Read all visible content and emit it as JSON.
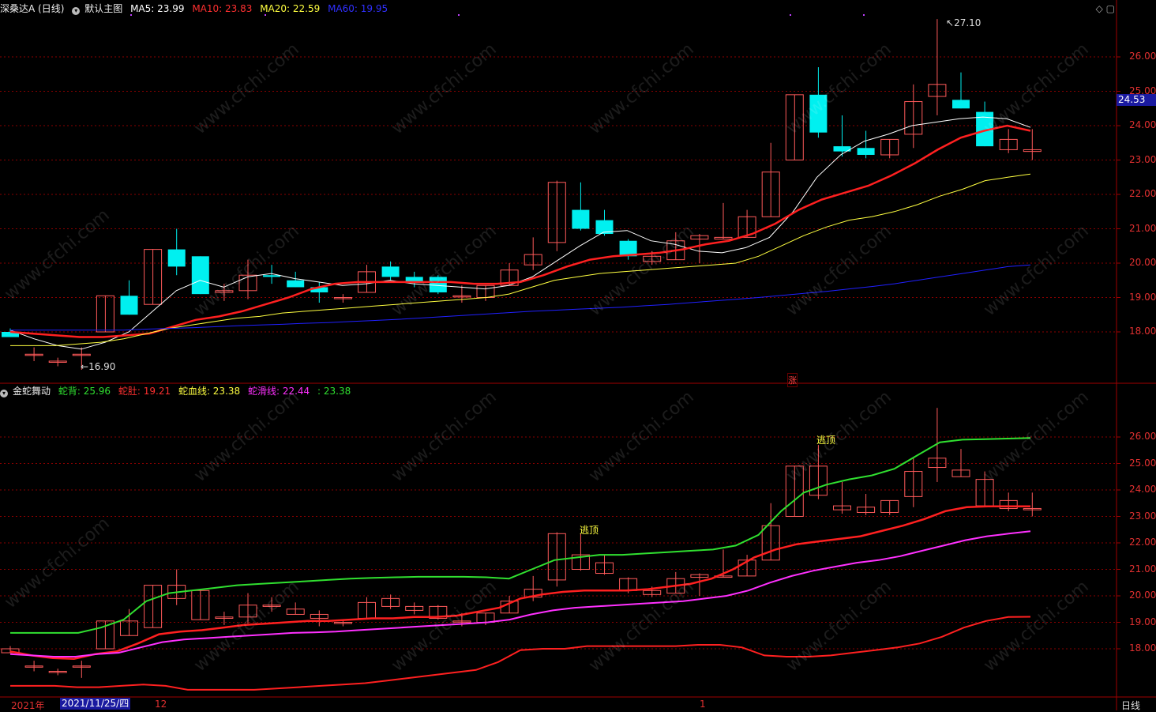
{
  "main_header": {
    "title": "深桑达A (日线)",
    "template": "默认主图",
    "ma5": "MA5: 23.99",
    "ma10": "MA10: 23.83",
    "ma20": "MA20: 22.59",
    "ma60": "MA60: 19.95"
  },
  "sub_header": {
    "title": "金蛇舞动",
    "back": "蛇背: 25.96",
    "belly": "蛇肚: 19.21",
    "blood": "蛇血线: 23.38",
    "slide": "蛇滑线: 22.44",
    "extra": ": 23.38"
  },
  "colors": {
    "up": "#ff5a5a",
    "down": "#00f0f0",
    "ma5": "#ffffff",
    "ma10": "#ff2020",
    "ma20": "#ffff40",
    "ma60": "#2020ff",
    "back": "#30e030",
    "slide": "#ff30ff",
    "blood": "#ff2020",
    "belly": "#ff2020",
    "grid": "#8a0000"
  },
  "price_tag": "24.53",
  "y_axis_main": [
    "26.00",
    "25.00",
    "24.00",
    "23.00",
    "22.00",
    "21.00",
    "20.00",
    "19.00",
    "18.00"
  ],
  "y_axis_sub": [
    "26.00",
    "25.00",
    "24.00",
    "23.00",
    "22.00",
    "21.00",
    "20.00",
    "19.00",
    "18.00"
  ],
  "x_axis": {
    "year": "2021年",
    "date": "2021/11/25/四",
    "dec": "12",
    "jan": "1",
    "period": "日线"
  },
  "annotations": {
    "high": "27.10",
    "low": "16.90",
    "escape1": "逃顶",
    "escape2": "逃顶",
    "zhang": "涨"
  },
  "watermark": "www.cfchi.com",
  "chart_data": [
    {
      "type": "candlestick",
      "title": "深桑达A (日线)",
      "candles": [
        {
          "o": 18.0,
          "h": 18.1,
          "l": 17.85,
          "c": 17.85
        },
        {
          "o": 17.35,
          "h": 17.55,
          "l": 17.15,
          "c": 17.35
        },
        {
          "o": 17.15,
          "h": 17.25,
          "l": 17.0,
          "c": 17.15
        },
        {
          "o": 17.35,
          "h": 17.55,
          "l": 16.9,
          "c": 17.35
        },
        {
          "o": 18.0,
          "h": 19.05,
          "l": 18.0,
          "c": 19.05
        },
        {
          "o": 19.05,
          "h": 19.5,
          "l": 18.5,
          "c": 18.5
        },
        {
          "o": 18.8,
          "h": 20.4,
          "l": 18.8,
          "c": 20.4
        },
        {
          "o": 20.4,
          "h": 21.0,
          "l": 19.65,
          "c": 19.9
        },
        {
          "o": 20.2,
          "h": 20.2,
          "l": 19.1,
          "c": 19.1
        },
        {
          "o": 19.15,
          "h": 19.4,
          "l": 18.9,
          "c": 19.2
        },
        {
          "o": 19.2,
          "h": 20.1,
          "l": 18.95,
          "c": 19.65
        },
        {
          "o": 19.65,
          "h": 19.95,
          "l": 19.4,
          "c": 19.6
        },
        {
          "o": 19.5,
          "h": 19.75,
          "l": 19.3,
          "c": 19.3
        },
        {
          "o": 19.3,
          "h": 19.45,
          "l": 18.85,
          "c": 19.15
        },
        {
          "o": 19.0,
          "h": 19.1,
          "l": 18.85,
          "c": 19.0
        },
        {
          "o": 19.15,
          "h": 19.95,
          "l": 19.15,
          "c": 19.75
        },
        {
          "o": 19.9,
          "h": 20.05,
          "l": 19.5,
          "c": 19.6
        },
        {
          "o": 19.6,
          "h": 19.75,
          "l": 19.3,
          "c": 19.45
        },
        {
          "o": 19.6,
          "h": 19.65,
          "l": 19.1,
          "c": 19.15
        },
        {
          "o": 19.05,
          "h": 19.35,
          "l": 18.85,
          "c": 19.05
        },
        {
          "o": 19.0,
          "h": 19.35,
          "l": 18.9,
          "c": 19.35
        },
        {
          "o": 19.35,
          "h": 20.0,
          "l": 19.35,
          "c": 19.8
        },
        {
          "o": 19.95,
          "h": 20.75,
          "l": 19.8,
          "c": 20.25
        },
        {
          "o": 20.6,
          "h": 22.4,
          "l": 20.35,
          "c": 22.35
        },
        {
          "o": 21.55,
          "h": 22.35,
          "l": 20.95,
          "c": 21.0
        },
        {
          "o": 21.25,
          "h": 21.55,
          "l": 20.8,
          "c": 20.85
        },
        {
          "o": 20.65,
          "h": 20.7,
          "l": 20.1,
          "c": 20.2
        },
        {
          "o": 20.05,
          "h": 20.35,
          "l": 19.95,
          "c": 20.2
        },
        {
          "o": 20.1,
          "h": 20.9,
          "l": 20.1,
          "c": 20.65
        },
        {
          "o": 20.7,
          "h": 20.85,
          "l": 20.0,
          "c": 20.8
        },
        {
          "o": 20.7,
          "h": 21.75,
          "l": 20.7,
          "c": 20.75
        },
        {
          "o": 20.75,
          "h": 21.55,
          "l": 20.75,
          "c": 21.35
        },
        {
          "o": 21.35,
          "h": 23.5,
          "l": 21.35,
          "c": 22.65
        },
        {
          "o": 23.0,
          "h": 24.9,
          "l": 23.0,
          "c": 24.9
        },
        {
          "o": 24.9,
          "h": 25.7,
          "l": 23.65,
          "c": 23.8
        },
        {
          "o": 23.4,
          "h": 24.3,
          "l": 23.1,
          "c": 23.25
        },
        {
          "o": 23.35,
          "h": 23.85,
          "l": 23.05,
          "c": 23.15
        },
        {
          "o": 23.15,
          "h": 23.6,
          "l": 23.05,
          "c": 23.6
        },
        {
          "o": 23.75,
          "h": 25.2,
          "l": 23.35,
          "c": 24.7
        },
        {
          "o": 24.85,
          "h": 27.1,
          "l": 24.3,
          "c": 25.2
        },
        {
          "o": 24.75,
          "h": 25.55,
          "l": 24.5,
          "c": 24.5
        },
        {
          "o": 24.4,
          "h": 24.7,
          "l": 23.4,
          "c": 23.4
        },
        {
          "o": 23.3,
          "h": 23.9,
          "l": 23.2,
          "c": 23.6
        },
        {
          "o": 23.25,
          "h": 23.9,
          "l": 23.0,
          "c": 23.3
        }
      ],
      "series": [
        {
          "name": "MA5",
          "values": [
            18.05,
            17.8,
            17.6,
            17.5,
            17.7,
            18.0,
            18.6,
            19.2,
            19.5,
            19.3,
            19.6,
            19.7,
            19.55,
            19.45,
            19.35,
            19.4,
            19.5,
            19.4,
            19.35,
            19.3,
            19.25,
            19.35,
            19.6,
            20.05,
            20.5,
            20.9,
            20.95,
            20.65,
            20.55,
            20.35,
            20.3,
            20.45,
            20.75,
            21.5,
            22.5,
            23.15,
            23.55,
            23.75,
            24.0,
            24.1,
            24.2,
            24.25,
            24.2,
            23.95
          ]
        },
        {
          "name": "MA10",
          "values": [
            18.0,
            17.95,
            17.9,
            17.85,
            17.85,
            17.9,
            17.95,
            18.15,
            18.35,
            18.45,
            18.6,
            18.8,
            19.0,
            19.25,
            19.4,
            19.45,
            19.45,
            19.45,
            19.45,
            19.45,
            19.4,
            19.4,
            19.45,
            19.65,
            19.9,
            20.1,
            20.2,
            20.25,
            20.3,
            20.4,
            20.55,
            20.65,
            20.85,
            21.15,
            21.55,
            21.85,
            22.05,
            22.25,
            22.55,
            22.9,
            23.3,
            23.65,
            23.85,
            24.0,
            23.85
          ]
        },
        {
          "name": "MA20",
          "values": [
            17.6,
            17.6,
            17.6,
            17.65,
            17.7,
            17.8,
            17.95,
            18.1,
            18.2,
            18.3,
            18.4,
            18.45,
            18.55,
            18.6,
            18.65,
            18.7,
            18.75,
            18.8,
            18.85,
            18.9,
            18.95,
            19.0,
            19.1,
            19.3,
            19.5,
            19.6,
            19.7,
            19.75,
            19.8,
            19.85,
            19.9,
            19.95,
            20.0,
            20.2,
            20.5,
            20.8,
            21.05,
            21.25,
            21.35,
            21.5,
            21.7,
            21.95,
            22.15,
            22.4,
            22.5,
            22.59
          ]
        },
        {
          "name": "MA60",
          "values": [
            18.05,
            18.05,
            18.05,
            18.05,
            18.05,
            18.05,
            18.08,
            18.1,
            18.12,
            18.15,
            18.18,
            18.2,
            18.22,
            18.25,
            18.27,
            18.3,
            18.33,
            18.36,
            18.4,
            18.44,
            18.48,
            18.52,
            18.56,
            18.6,
            18.63,
            18.66,
            18.69,
            18.72,
            18.76,
            18.8,
            18.85,
            18.9,
            18.95,
            19.0,
            19.06,
            19.12,
            19.18,
            19.25,
            19.32,
            19.4,
            19.5,
            19.6,
            19.7,
            19.8,
            19.9,
            19.95
          ]
        }
      ],
      "ylim": [
        16.8,
        27.4
      ]
    },
    {
      "type": "candlestick",
      "title": "金蛇舞动",
      "series": [
        {
          "name": "蛇背",
          "values": [
            18.6,
            18.6,
            18.6,
            18.6,
            18.8,
            19.1,
            19.8,
            20.1,
            20.2,
            20.3,
            20.4,
            20.45,
            20.5,
            20.55,
            20.6,
            20.65,
            20.68,
            20.7,
            20.72,
            20.72,
            20.72,
            20.7,
            20.65,
            21.0,
            21.35,
            21.45,
            21.55,
            21.55,
            21.6,
            21.65,
            21.7,
            21.75,
            21.9,
            22.3,
            23.2,
            23.9,
            24.2,
            24.4,
            24.55,
            24.8,
            25.3,
            25.8,
            25.9,
            25.92,
            25.94,
            25.96
          ]
        },
        {
          "name": "蛇血线",
          "values": [
            17.9,
            17.75,
            17.65,
            17.62,
            17.8,
            17.9,
            18.2,
            18.55,
            18.65,
            18.7,
            18.8,
            18.9,
            18.95,
            19.0,
            19.05,
            19.05,
            19.1,
            19.15,
            19.15,
            19.2,
            19.2,
            19.25,
            19.4,
            19.55,
            19.9,
            20.05,
            20.15,
            20.2,
            20.2,
            20.2,
            20.25,
            20.35,
            20.45,
            20.65,
            21.0,
            21.45,
            21.75,
            21.95,
            22.05,
            22.15,
            22.25,
            22.45,
            22.65,
            22.9,
            23.2,
            23.35,
            23.38,
            23.38,
            23.38
          ]
        },
        {
          "name": "蛇滑线",
          "values": [
            17.8,
            17.75,
            17.7,
            17.7,
            17.8,
            17.85,
            18.05,
            18.25,
            18.35,
            18.4,
            18.45,
            18.5,
            18.55,
            18.6,
            18.62,
            18.65,
            18.7,
            18.75,
            18.8,
            18.85,
            18.9,
            18.95,
            19.0,
            19.1,
            19.3,
            19.45,
            19.55,
            19.6,
            19.65,
            19.7,
            19.75,
            19.8,
            19.9,
            20.0,
            20.2,
            20.5,
            20.75,
            20.95,
            21.1,
            21.25,
            21.35,
            21.5,
            21.7,
            21.9,
            22.1,
            22.25,
            22.35,
            22.44
          ]
        },
        {
          "name": "蛇肚",
          "values": [
            16.6,
            16.6,
            16.6,
            16.55,
            16.55,
            16.6,
            16.65,
            16.6,
            16.45,
            16.45,
            16.45,
            16.45,
            16.5,
            16.55,
            16.6,
            16.65,
            16.7,
            16.8,
            16.9,
            17.0,
            17.1,
            17.2,
            17.5,
            17.95,
            18.0,
            18.0,
            18.1,
            18.1,
            18.1,
            18.1,
            18.1,
            18.15,
            18.15,
            18.05,
            17.75,
            17.7,
            17.7,
            17.75,
            17.85,
            17.95,
            18.05,
            18.2,
            18.45,
            18.8,
            19.05,
            19.2,
            19.21
          ]
        }
      ],
      "ylim": [
        16.8,
        27.4
      ]
    }
  ]
}
